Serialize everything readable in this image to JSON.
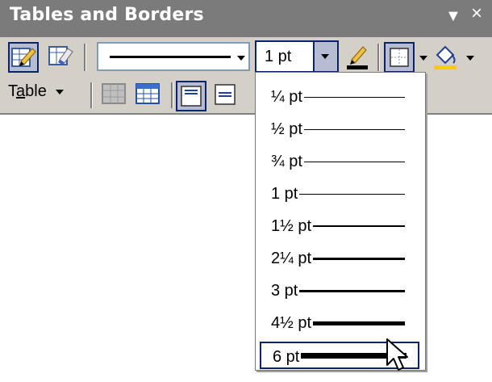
{
  "toolbar": {
    "title": "Tables and Borders",
    "title_menu_glyph": "▼",
    "title_close_glyph": "×",
    "line_weight_value": "1 pt",
    "table_menu_label": "Table",
    "table_menu_label_rest": "able"
  },
  "icons": {
    "draw_table": "pencil-icon",
    "eraser": "eraser-icon",
    "border_color": "border-color-pencil-icon",
    "outside_border": "outside-border-icon",
    "shading_color": "paint-bucket-icon",
    "insert_table": "insert-table-icon",
    "merge_cells": "merge-cells-icon",
    "align_top": "align-top-icon",
    "align_center": "align-center-icon",
    "cursor": "mouse-pointer-icon"
  },
  "colors": {
    "titlebar": "#7b7b7b",
    "toolbar_bg": "#d4d0c8",
    "highlight_border": "#0a246a",
    "highlight_fill": "#b6bdd2",
    "border_color_swatch": "#000000",
    "shading_swatch": "#ffcc00"
  },
  "line_weight_options": [
    {
      "label": "¼ pt",
      "weight_pt": 0.25
    },
    {
      "label": "½ pt",
      "weight_pt": 0.5
    },
    {
      "label": "¾ pt",
      "weight_pt": 0.75
    },
    {
      "label": "1 pt",
      "weight_pt": 1
    },
    {
      "label": "1½ pt",
      "weight_pt": 1.5
    },
    {
      "label": "2¼ pt",
      "weight_pt": 2.25
    },
    {
      "label": "3 pt",
      "weight_pt": 3
    },
    {
      "label": "4½ pt",
      "weight_pt": 4.5
    },
    {
      "label": "6 pt",
      "weight_pt": 6,
      "selected": true
    }
  ]
}
